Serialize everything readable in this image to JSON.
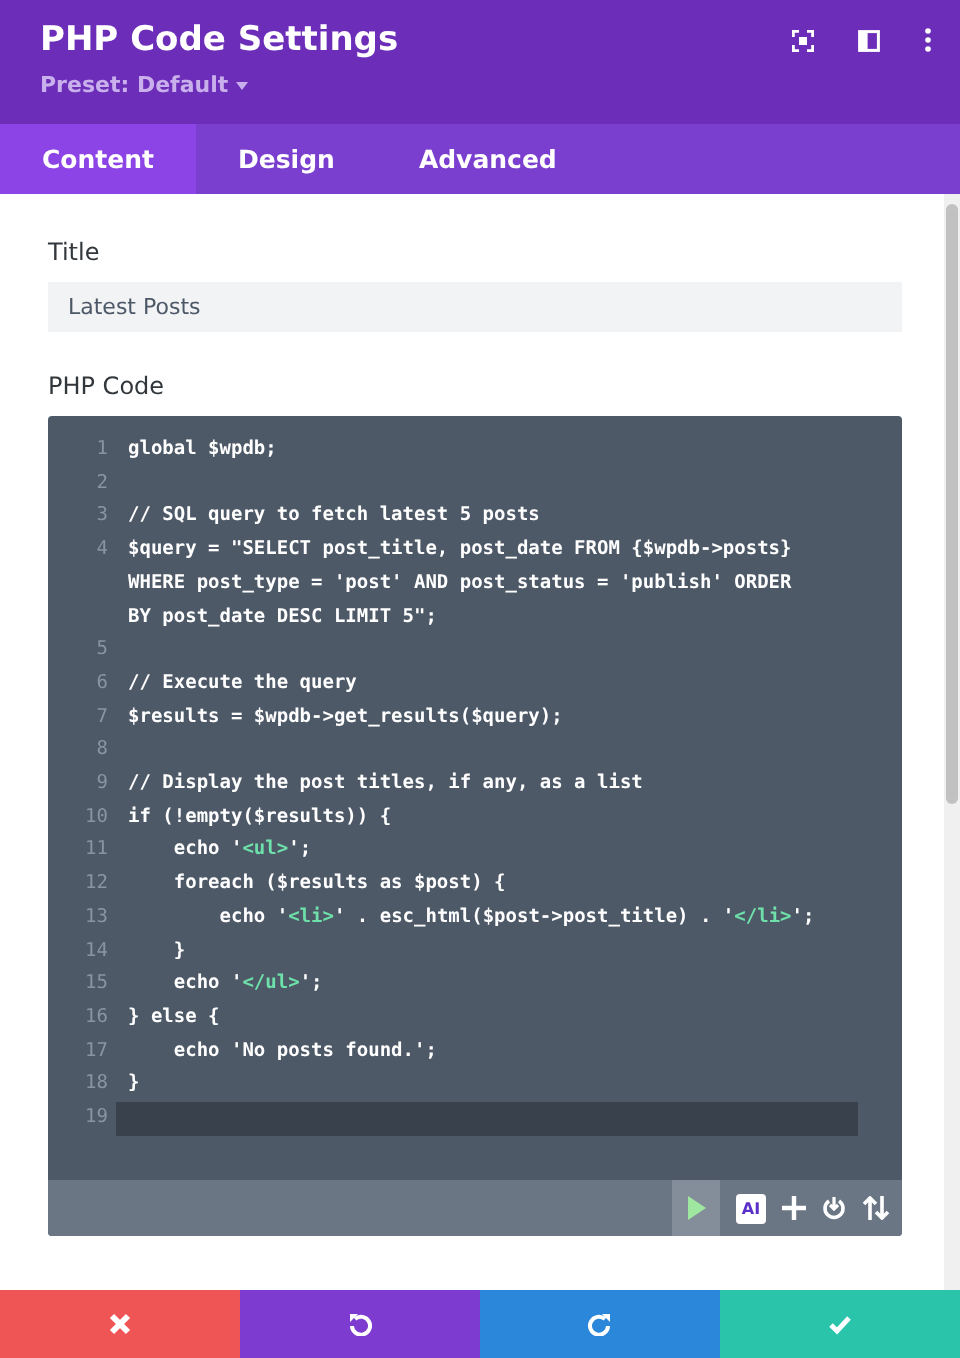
{
  "header": {
    "title": "PHP Code Settings",
    "preset": "Preset: Default"
  },
  "tabs": [
    {
      "label": "Content",
      "selected": true
    },
    {
      "label": "Design",
      "selected": false
    },
    {
      "label": "Advanced",
      "selected": false
    }
  ],
  "fields": {
    "title_label": "Title",
    "title_value": "Latest Posts",
    "code_label": "PHP Code"
  },
  "editor": {
    "lines": [
      {
        "number": "1",
        "active": false,
        "rows": [
          [
            {
              "text": "global $wpdb;",
              "kind": "code"
            }
          ]
        ]
      },
      {
        "number": "2",
        "active": false,
        "rows": [
          []
        ]
      },
      {
        "number": "3",
        "active": false,
        "rows": [
          [
            {
              "text": "// SQL query to fetch latest 5 posts",
              "kind": "code"
            }
          ]
        ]
      },
      {
        "number": "4",
        "active": false,
        "rows": [
          [
            {
              "text": "$query = \"SELECT post_title, post_date FROM {$wpdb->posts}",
              "kind": "code"
            }
          ],
          [
            {
              "text": "WHERE post_type = 'post' AND post_status = 'publish' ORDER",
              "kind": "code"
            }
          ],
          [
            {
              "text": "BY post_date DESC LIMIT 5\";",
              "kind": "code"
            }
          ]
        ]
      },
      {
        "number": "5",
        "active": false,
        "rows": [
          []
        ]
      },
      {
        "number": "6",
        "active": false,
        "rows": [
          [
            {
              "text": "// Execute the query",
              "kind": "code"
            }
          ]
        ]
      },
      {
        "number": "7",
        "active": false,
        "rows": [
          [
            {
              "text": "$results = $wpdb->get_results($query);",
              "kind": "code"
            }
          ]
        ]
      },
      {
        "number": "8",
        "active": false,
        "rows": [
          []
        ]
      },
      {
        "number": "9",
        "active": false,
        "rows": [
          [
            {
              "text": "// Display the post titles, if any, as a list",
              "kind": "code"
            }
          ]
        ]
      },
      {
        "number": "10",
        "active": false,
        "rows": [
          [
            {
              "text": "if (!empty($results)) {",
              "kind": "code"
            }
          ]
        ]
      },
      {
        "number": "11",
        "active": false,
        "rows": [
          [
            {
              "text": "    echo '",
              "kind": "code"
            },
            {
              "text": "<ul>",
              "kind": "tag"
            },
            {
              "text": "';",
              "kind": "code"
            }
          ]
        ]
      },
      {
        "number": "12",
        "active": false,
        "rows": [
          [
            {
              "text": "    foreach ($results as $post) {",
              "kind": "code"
            }
          ]
        ]
      },
      {
        "number": "13",
        "active": false,
        "rows": [
          [
            {
              "text": "        echo '",
              "kind": "code"
            },
            {
              "text": "<li>",
              "kind": "tag"
            },
            {
              "text": "' . esc_html($post->post_title) . '",
              "kind": "code"
            },
            {
              "text": "</li>",
              "kind": "tag"
            },
            {
              "text": "';",
              "kind": "code"
            }
          ]
        ]
      },
      {
        "number": "14",
        "active": false,
        "rows": [
          [
            {
              "text": "    }",
              "kind": "code"
            }
          ]
        ]
      },
      {
        "number": "15",
        "active": false,
        "rows": [
          [
            {
              "text": "    echo '",
              "kind": "code"
            },
            {
              "text": "</ul>",
              "kind": "tag"
            },
            {
              "text": "';",
              "kind": "code"
            }
          ]
        ]
      },
      {
        "number": "16",
        "active": false,
        "rows": [
          [
            {
              "text": "} else {",
              "kind": "code"
            }
          ]
        ]
      },
      {
        "number": "17",
        "active": false,
        "rows": [
          [
            {
              "text": "    echo 'No posts found.';",
              "kind": "code"
            }
          ]
        ]
      },
      {
        "number": "18",
        "active": false,
        "rows": [
          [
            {
              "text": "}",
              "kind": "code"
            }
          ]
        ]
      },
      {
        "number": "19",
        "active": true,
        "rows": [
          []
        ]
      }
    ],
    "ai_label": "AI"
  }
}
